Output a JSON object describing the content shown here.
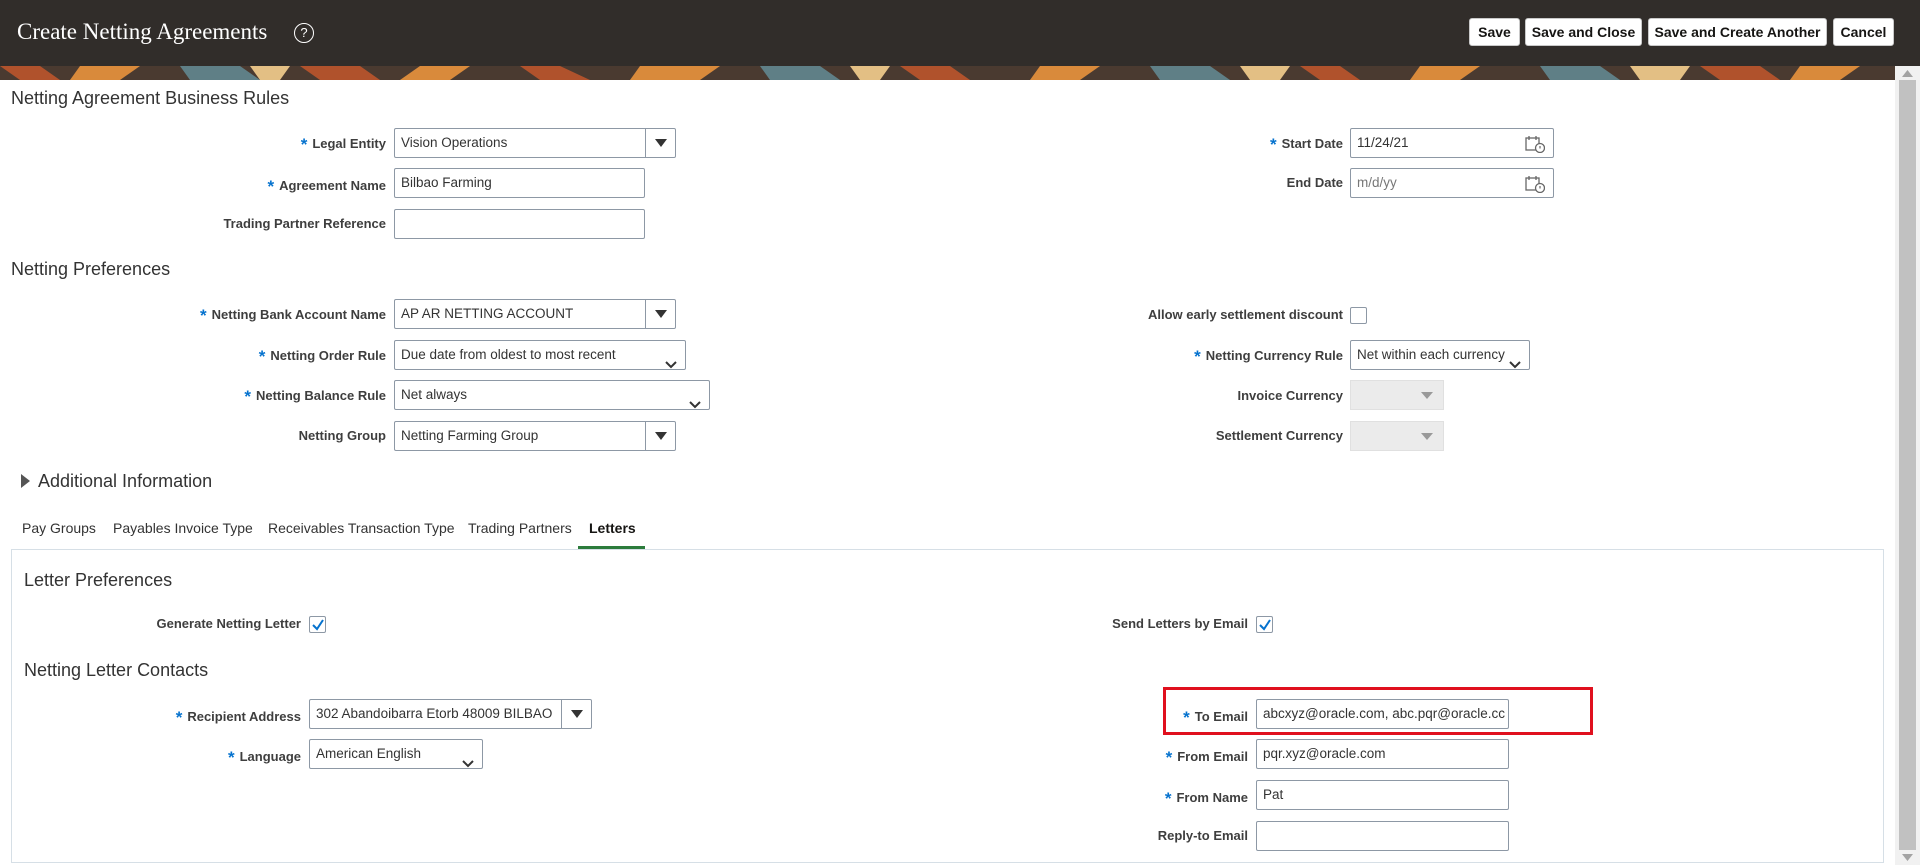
{
  "header": {
    "title": "Create Netting Agreements",
    "help_icon": "question-circle-icon",
    "buttons": {
      "save": "Save",
      "save_and_close": "Save and Close",
      "save_and_create_another": "Save and Create Another",
      "cancel": "Cancel"
    }
  },
  "colors": {
    "header_bg": "#312d2a",
    "required_marker": "#0572ce",
    "active_tab_underline": "#2c7c3c",
    "highlight_box": "#e0101e"
  },
  "business_rules": {
    "heading": "Netting Agreement Business Rules",
    "legal_entity": {
      "label": "Legal Entity",
      "value": "Vision Operations"
    },
    "agreement_name": {
      "label": "Agreement Name",
      "value": "Bilbao Farming"
    },
    "trading_partner_reference": {
      "label": "Trading Partner Reference",
      "value": ""
    },
    "start_date": {
      "label": "Start Date",
      "value": "11/24/21"
    },
    "end_date": {
      "label": "End Date",
      "value": "",
      "placeholder": "m/d/yy"
    }
  },
  "preferences": {
    "heading": "Netting Preferences",
    "bank_account": {
      "label": "Netting Bank Account Name",
      "value": "AP AR NETTING ACCOUNT"
    },
    "order_rule": {
      "label": "Netting Order Rule",
      "value": "Due date from oldest to most recent"
    },
    "balance_rule": {
      "label": "Netting Balance Rule",
      "value": "Net always"
    },
    "netting_group": {
      "label": "Netting Group",
      "value": "Netting Farming Group"
    },
    "early_settlement": {
      "label": "Allow early settlement discount",
      "checked": false
    },
    "currency_rule": {
      "label": "Netting Currency Rule",
      "value": "Net within each currency"
    },
    "invoice_currency": {
      "label": "Invoice Currency",
      "value": ""
    },
    "settlement_currency": {
      "label": "Settlement Currency",
      "value": ""
    }
  },
  "additional_info": {
    "label": "Additional Information",
    "expanded": false
  },
  "tabs": [
    {
      "label": "Pay Groups",
      "active": false
    },
    {
      "label": "Payables Invoice Type",
      "active": false
    },
    {
      "label": "Receivables Transaction Type",
      "active": false
    },
    {
      "label": "Trading Partners",
      "active": false
    },
    {
      "label": "Letters",
      "active": true
    }
  ],
  "letters": {
    "preferences_heading": "Letter Preferences",
    "generate_letter": {
      "label": "Generate Netting Letter",
      "checked": true
    },
    "send_by_email": {
      "label": "Send Letters by Email",
      "checked": true
    },
    "contacts_heading": "Netting Letter Contacts",
    "recipient_address": {
      "label": "Recipient Address",
      "value": "302 Abandoibarra Etorb 48009 BILBAO"
    },
    "language": {
      "label": "Language",
      "value": "American English"
    },
    "to_email": {
      "label": "To Email",
      "value": "abcxyz@oracle.com, abc.pqr@oracle.cc"
    },
    "from_email": {
      "label": "From Email",
      "value": "pqr.xyz@oracle.com"
    },
    "from_name": {
      "label": "From Name",
      "value": "Pat"
    },
    "reply_to_email": {
      "label": "Reply-to Email",
      "value": ""
    }
  }
}
